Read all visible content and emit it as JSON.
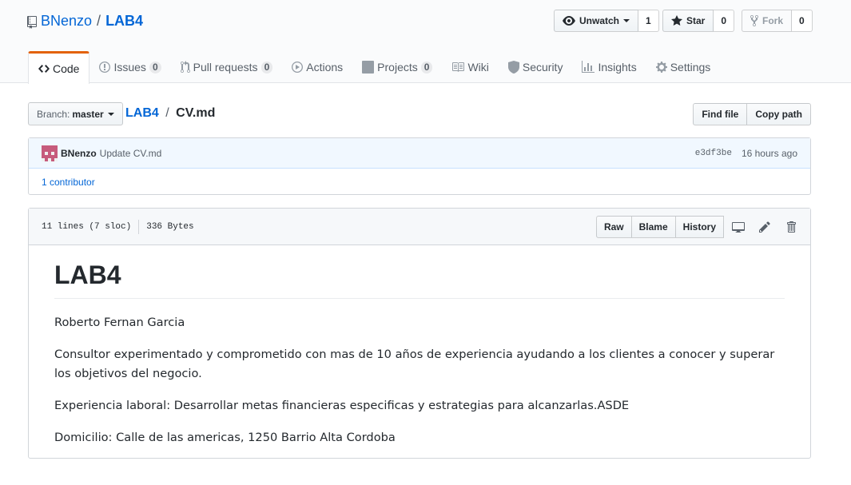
{
  "repo": {
    "owner": "BNenzo",
    "separator": "/",
    "name": "LAB4"
  },
  "actions": {
    "watch": {
      "label": "Unwatch",
      "count": "1"
    },
    "star": {
      "label": "Star",
      "count": "0"
    },
    "fork": {
      "label": "Fork",
      "count": "0"
    }
  },
  "tabs": [
    {
      "label": "Code",
      "icon": "code-icon",
      "selected": true
    },
    {
      "label": "Issues",
      "icon": "issue-icon",
      "badge": "0"
    },
    {
      "label": "Pull requests",
      "icon": "pull-request-icon",
      "badge": "0"
    },
    {
      "label": "Actions",
      "icon": "play-icon"
    },
    {
      "label": "Projects",
      "icon": "project-icon",
      "badge": "0"
    },
    {
      "label": "Wiki",
      "icon": "book-icon"
    },
    {
      "label": "Security",
      "icon": "shield-icon"
    },
    {
      "label": "Insights",
      "icon": "graph-icon"
    },
    {
      "label": "Settings",
      "icon": "gear-icon"
    }
  ],
  "branch": {
    "prefix": "Branch:",
    "name": "master"
  },
  "breadcrumb": {
    "root": "LAB4",
    "separator": "/",
    "file": "CV.md"
  },
  "file_buttons": {
    "find": "Find file",
    "copy": "Copy path"
  },
  "commit": {
    "author": "BNenzo",
    "message": "Update CV.md",
    "sha": "e3df3be",
    "time": "16 hours ago",
    "contributors": "1 contributor"
  },
  "file": {
    "lines": "11 lines (7 sloc)",
    "size": "336 Bytes",
    "buttons": {
      "raw": "Raw",
      "blame": "Blame",
      "history": "History"
    }
  },
  "content": {
    "heading": "LAB4",
    "paragraphs": [
      "Roberto Fernan Garcia",
      "Consultor experimentado y comprometido con mas de 10 años de experiencia ayudando a los clientes a conocer y superar los objetivos del negocio.",
      "Experiencia laboral: Desarrollar metas financieras especificas y estrategias para alcanzarlas.ASDE",
      "Domicilio: Calle de las americas, 1250 Barrio Alta Cordoba"
    ]
  },
  "colors": {
    "link": "#0366d6",
    "tab_accent": "#e36209",
    "commit_bg": "#f1f8ff"
  }
}
